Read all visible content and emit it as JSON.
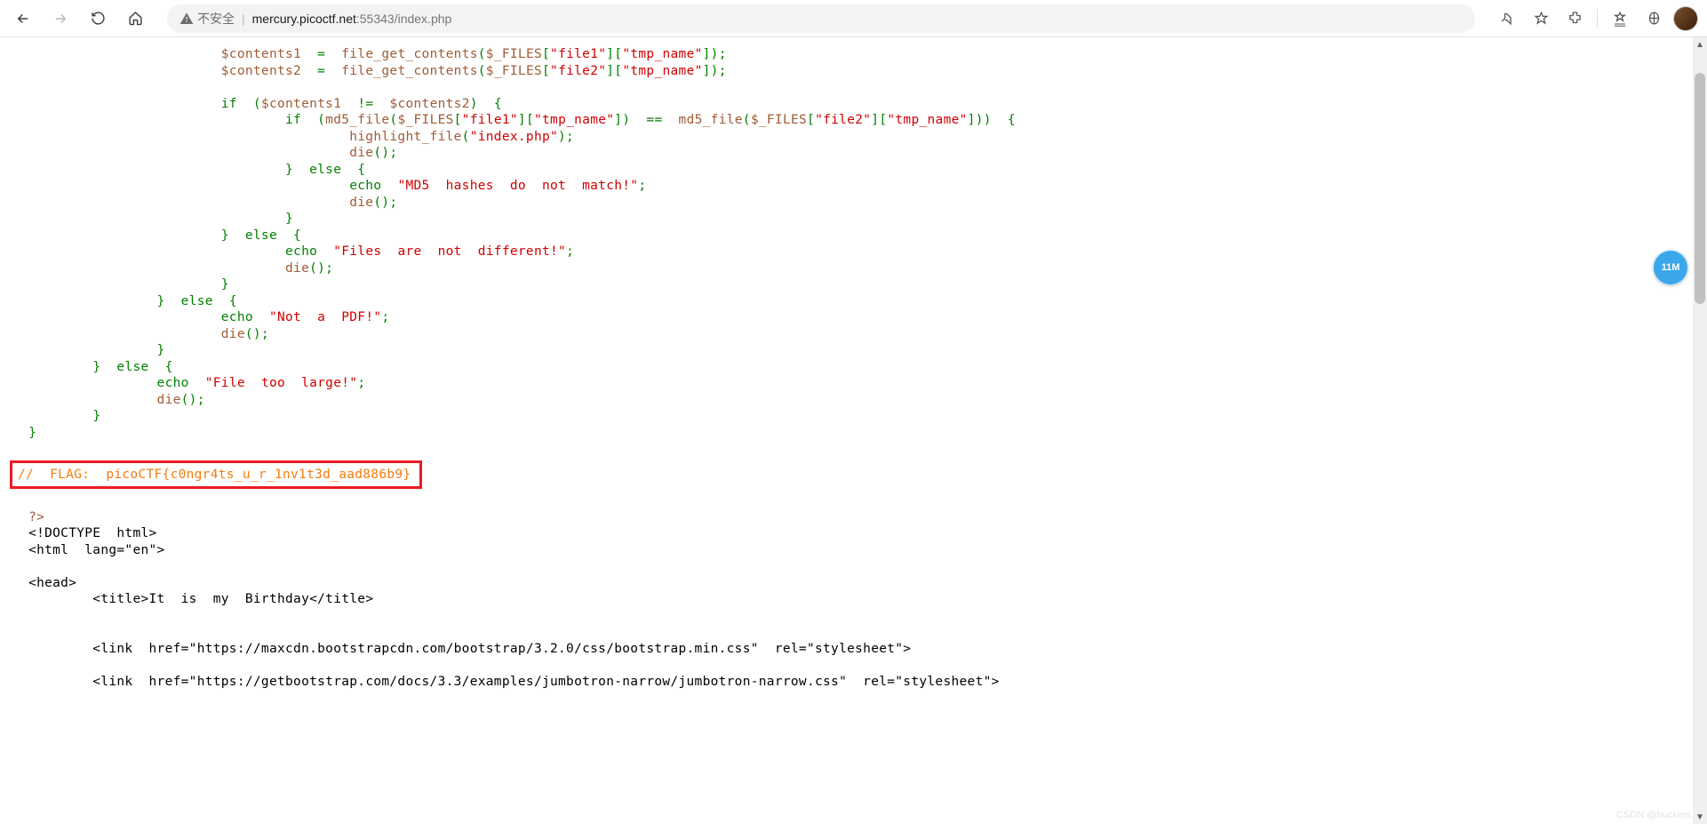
{
  "address": {
    "insecure_label": "不安全",
    "host": "mercury.picoctf.net",
    "port_path": ":55343/index.php"
  },
  "badge": {
    "label": "11M"
  },
  "watermark": "CSDN @huckers",
  "code": {
    "line1_a": "$contents1",
    "line1_b": "=",
    "line1_c": "file_get_contents",
    "line1_d": "(",
    "line1_e": "$_FILES",
    "line1_f": "[",
    "line1_g": "\"file1\"",
    "line1_h": "][",
    "line1_i": "\"tmp_name\"",
    "line1_j": "]);",
    "line2_a": "$contents2",
    "line2_b": "=",
    "line2_c": "file_get_contents",
    "line2_d": "(",
    "line2_e": "$_FILES",
    "line2_f": "[",
    "line2_g": "\"file2\"",
    "line2_h": "][",
    "line2_i": "\"tmp_name\"",
    "line2_j": "]);",
    "line3_a": "if",
    "line3_b": "(",
    "line3_c": "$contents1",
    "line3_d": "!=",
    "line3_e": "$contents2",
    "line3_f": ")  {",
    "line4_a": "if",
    "line4_b": "(",
    "line4_c": "md5_file",
    "line4_d": "(",
    "line4_e": "$_FILES",
    "line4_f": "[",
    "line4_g": "\"file1\"",
    "line4_h": "][",
    "line4_i": "\"tmp_name\"",
    "line4_j": "])  ==",
    "line4_k": "md5_file",
    "line4_l": "(",
    "line4_m": "$_FILES",
    "line4_n": "[",
    "line4_o": "\"file2\"",
    "line4_p": "][",
    "line4_q": "\"tmp_name\"",
    "line4_r": "]))  {",
    "line5_a": "highlight_file",
    "line5_b": "(",
    "line5_c": "\"index.php\"",
    "line5_d": ");",
    "line6_a": "die",
    "line6_b": "();",
    "line7": "}  else  {",
    "line8_a": "echo",
    "line8_b": "\"MD5  hashes  do  not  match!\"",
    "line8_c": ";",
    "line9_a": "die",
    "line9_b": "();",
    "line10": "}",
    "line11": "}  else  {",
    "line12_a": "echo",
    "line12_b": "\"Files  are  not  different!\"",
    "line12_c": ";",
    "line13_a": "die",
    "line13_b": "();",
    "line14": "}",
    "line15": "}  else  {",
    "line16_a": "echo",
    "line16_b": "\"Not  a  PDF!\"",
    "line16_c": ";",
    "line17_a": "die",
    "line17_b": "();",
    "line18": "}",
    "line19": "}  else  {",
    "line20_a": "echo",
    "line20_b": "\"File  too  large!\"",
    "line20_c": ";",
    "line21_a": "die",
    "line21_b": "();",
    "line22": "}",
    "line23": "}",
    "flag": "//  FLAG:  picoCTF{c0ngr4ts_u_r_1nv1t3d_aad886b9}",
    "php_close": "?>",
    "html1": "<!DOCTYPE  html>",
    "html2": "<html  lang=\"en\">",
    "head_open": "<head>",
    "title_line": "    <title>It  is  my  Birthday</title>",
    "link1": "    <link  href=\"https://maxcdn.bootstrapcdn.com/bootstrap/3.2.0/css/bootstrap.min.css\"  rel=\"stylesheet\">",
    "link2": "    <link  href=\"https://getbootstrap.com/docs/3.3/examples/jumbotron-narrow/jumbotron-narrow.css\"  rel=\"stylesheet\">"
  }
}
